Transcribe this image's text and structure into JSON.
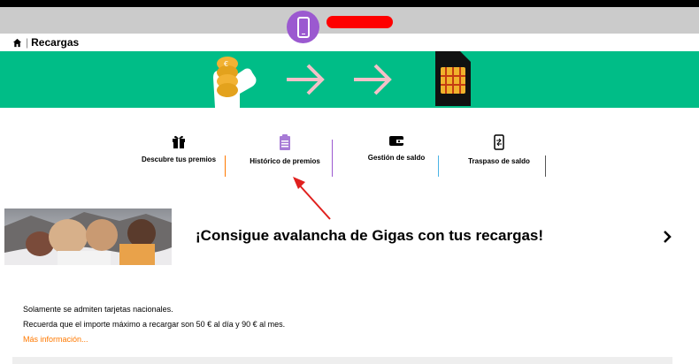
{
  "breadcrumb": {
    "label": "Recargas"
  },
  "tabs": [
    {
      "label": "Descubre tus premios",
      "icon": "gift-icon"
    },
    {
      "label": "Histórico de premios",
      "icon": "clipboard-icon"
    },
    {
      "label": "Gestión de saldo",
      "icon": "wallet-icon"
    },
    {
      "label": "Traspaso de saldo",
      "icon": "phone-transfer-icon"
    }
  ],
  "promo": {
    "title": "¡Consigue avalancha de Gigas con tus recargas!"
  },
  "info": {
    "line1_pre": "Solamente se admiten ",
    "line1_bold": "tarjetas nacionales.",
    "line2_pre": "Recuerda que el importe máximo a recargar son ",
    "line2_a": "50 € al día",
    "line2_mid": " y ",
    "line2_b": "90 € al mes.",
    "more_link": "Más información..."
  },
  "colors": {
    "banner": "#00bd87",
    "accent_orange": "#ff7900",
    "accent_purple": "#9b59d0",
    "annotation_red": "#e0201e"
  }
}
